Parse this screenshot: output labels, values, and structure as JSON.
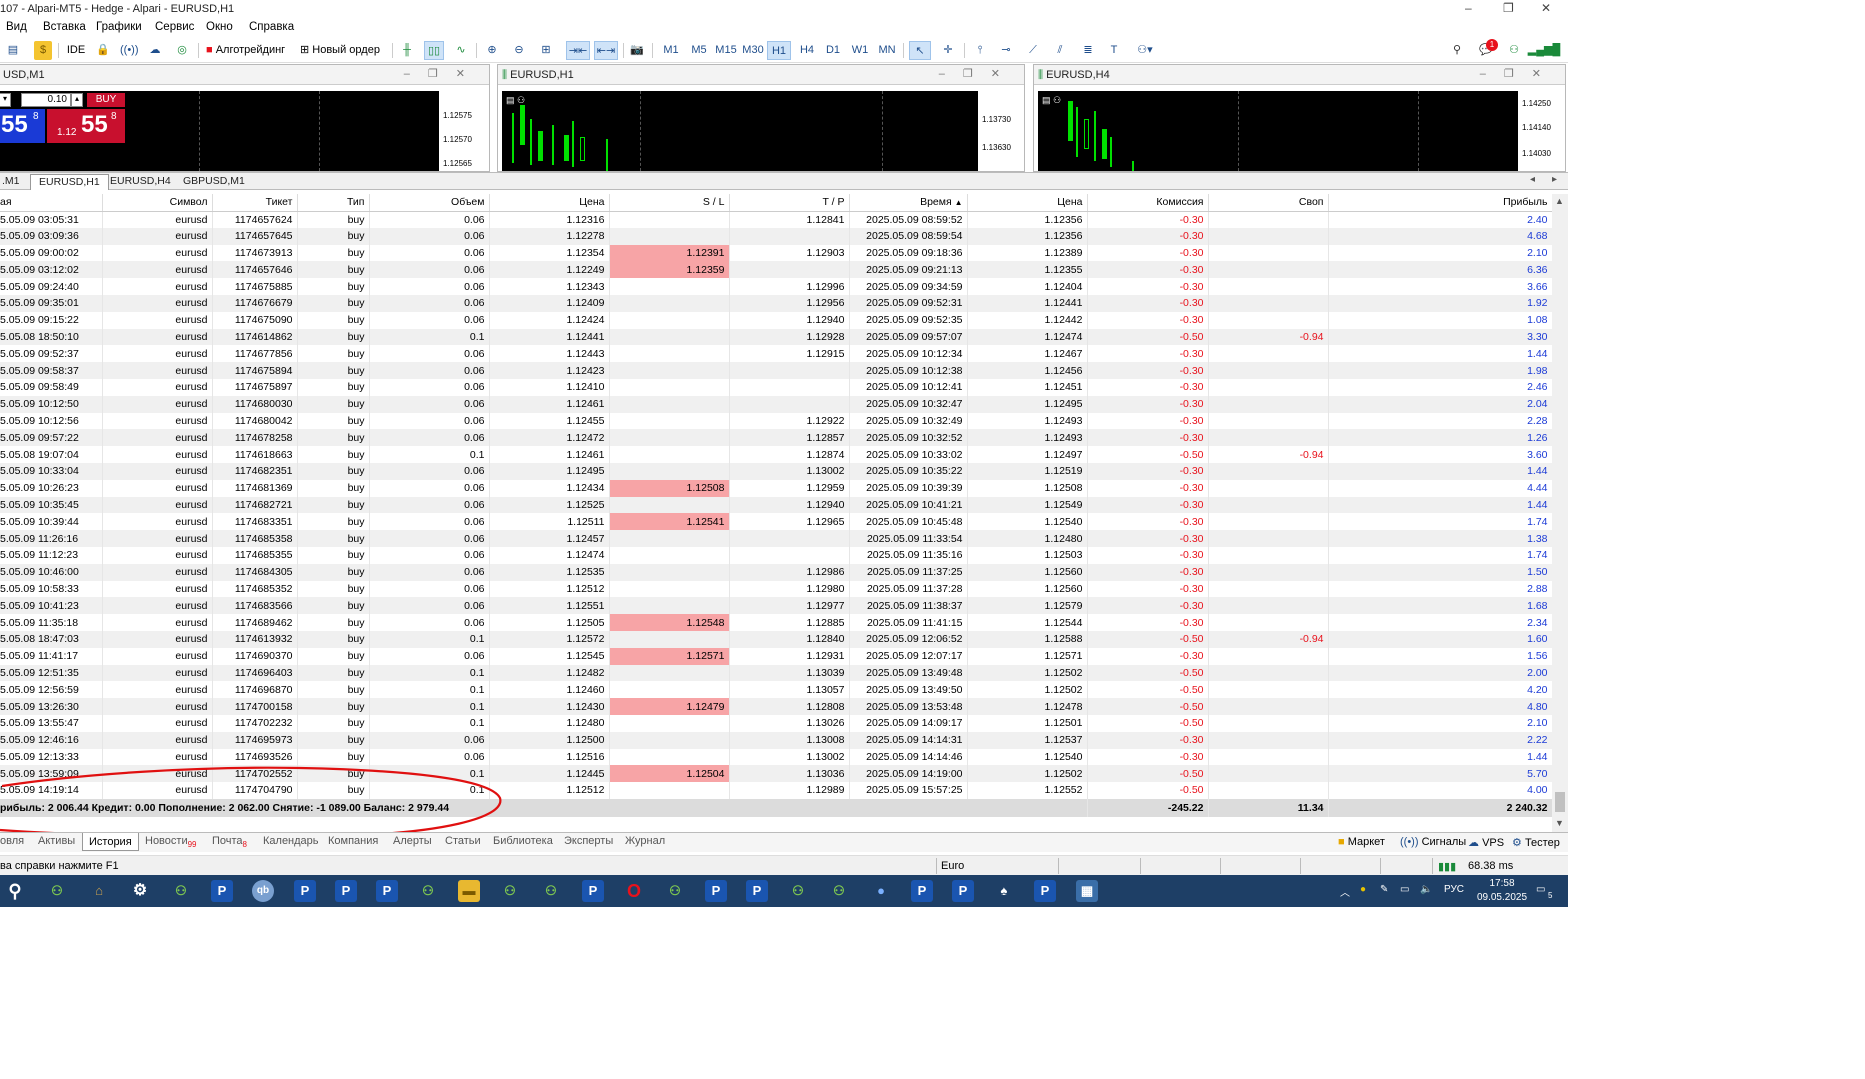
{
  "window": {
    "title": "107 - Alpari-MT5 - Hedge - Alpari - EURUSD,H1",
    "controls": [
      "–",
      "❐",
      "✕"
    ]
  },
  "menu": [
    "Вид",
    "Вставка",
    "Графики",
    "Сервис",
    "Окно",
    "Справка"
  ],
  "toolbar": {
    "ide": "IDE",
    "algotrading": "Алготрейдинг",
    "new_order": "Новый ордер",
    "timeframes": [
      "M1",
      "M5",
      "M15",
      "M30",
      "H1",
      "H4",
      "D1",
      "W1",
      "MN"
    ],
    "selected_timeframe": "H1",
    "notification_count": "1"
  },
  "charts": [
    {
      "title": "USD,M1",
      "lot": "0.10",
      "buy_label": "BUY",
      "sell_price_big": "55",
      "sell_price_sup": "8",
      "buy_price_prefix": "1.12",
      "buy_price_big": "55",
      "buy_price_sup": "8",
      "scale": [
        "1.12575",
        "1.12570",
        "1.12565"
      ]
    },
    {
      "title": "EURUSD,H1",
      "scale": [
        "1.13730",
        "1.13630"
      ]
    },
    {
      "title": "EURUSD,H4",
      "scale": [
        "1.14250",
        "1.14140",
        "1.14030"
      ]
    }
  ],
  "chart_tabs": [
    ".M1",
    "EURUSD,H1",
    "EURUSD,H4",
    "GBPUSD,M1"
  ],
  "active_chart_tab": "EURUSD,H1",
  "table": {
    "headers": [
      "ая",
      "Символ",
      "Тикет",
      "Тип",
      "Объем",
      "Цена",
      "S / L",
      "T / P",
      "Время",
      "Цена",
      "Комиссия",
      "Своп",
      "Прибыль"
    ],
    "rows": [
      [
        "5.05.09 03:05:31",
        "eurusd",
        "1174657624",
        "buy",
        "0.06",
        "1.12316",
        "",
        "1.12841",
        "2025.05.09 08:59:52",
        "1.12356",
        "-0.30",
        "",
        "2.40"
      ],
      [
        "5.05.09 03:09:36",
        "eurusd",
        "1174657645",
        "buy",
        "0.06",
        "1.12278",
        "",
        "",
        "2025.05.09 08:59:54",
        "1.12356",
        "-0.30",
        "",
        "4.68"
      ],
      [
        "5.05.09 09:00:02",
        "eurusd",
        "1174673913",
        "buy",
        "0.06",
        "1.12354",
        "1.12391",
        "1.12903",
        "2025.05.09 09:18:36",
        "1.12389",
        "-0.30",
        "",
        "2.10"
      ],
      [
        "5.05.09 03:12:02",
        "eurusd",
        "1174657646",
        "buy",
        "0.06",
        "1.12249",
        "1.12359",
        "",
        "2025.05.09 09:21:13",
        "1.12355",
        "-0.30",
        "",
        "6.36"
      ],
      [
        "5.05.09 09:24:40",
        "eurusd",
        "1174675885",
        "buy",
        "0.06",
        "1.12343",
        "",
        "1.12996",
        "2025.05.09 09:34:59",
        "1.12404",
        "-0.30",
        "",
        "3.66"
      ],
      [
        "5.05.09 09:35:01",
        "eurusd",
        "1174676679",
        "buy",
        "0.06",
        "1.12409",
        "",
        "1.12956",
        "2025.05.09 09:52:31",
        "1.12441",
        "-0.30",
        "",
        "1.92"
      ],
      [
        "5.05.09 09:15:22",
        "eurusd",
        "1174675090",
        "buy",
        "0.06",
        "1.12424",
        "",
        "1.12940",
        "2025.05.09 09:52:35",
        "1.12442",
        "-0.30",
        "",
        "1.08"
      ],
      [
        "5.05.08 18:50:10",
        "eurusd",
        "1174614862",
        "buy",
        "0.1",
        "1.12441",
        "",
        "1.12928",
        "2025.05.09 09:57:07",
        "1.12474",
        "-0.50",
        "-0.94",
        "3.30"
      ],
      [
        "5.05.09 09:52:37",
        "eurusd",
        "1174677856",
        "buy",
        "0.06",
        "1.12443",
        "",
        "1.12915",
        "2025.05.09 10:12:34",
        "1.12467",
        "-0.30",
        "",
        "1.44"
      ],
      [
        "5.05.09 09:58:37",
        "eurusd",
        "1174675894",
        "buy",
        "0.06",
        "1.12423",
        "",
        "",
        "2025.05.09 10:12:38",
        "1.12456",
        "-0.30",
        "",
        "1.98"
      ],
      [
        "5.05.09 09:58:49",
        "eurusd",
        "1174675897",
        "buy",
        "0.06",
        "1.12410",
        "",
        "",
        "2025.05.09 10:12:41",
        "1.12451",
        "-0.30",
        "",
        "2.46"
      ],
      [
        "5.05.09 10:12:50",
        "eurusd",
        "1174680030",
        "buy",
        "0.06",
        "1.12461",
        "",
        "",
        "2025.05.09 10:32:47",
        "1.12495",
        "-0.30",
        "",
        "2.04"
      ],
      [
        "5.05.09 10:12:56",
        "eurusd",
        "1174680042",
        "buy",
        "0.06",
        "1.12455",
        "",
        "1.12922",
        "2025.05.09 10:32:49",
        "1.12493",
        "-0.30",
        "",
        "2.28"
      ],
      [
        "5.05.09 09:57:22",
        "eurusd",
        "1174678258",
        "buy",
        "0.06",
        "1.12472",
        "",
        "1.12857",
        "2025.05.09 10:32:52",
        "1.12493",
        "-0.30",
        "",
        "1.26"
      ],
      [
        "5.05.08 19:07:04",
        "eurusd",
        "1174618663",
        "buy",
        "0.1",
        "1.12461",
        "",
        "1.12874",
        "2025.05.09 10:33:02",
        "1.12497",
        "-0.50",
        "-0.94",
        "3.60"
      ],
      [
        "5.05.09 10:33:04",
        "eurusd",
        "1174682351",
        "buy",
        "0.06",
        "1.12495",
        "",
        "1.13002",
        "2025.05.09 10:35:22",
        "1.12519",
        "-0.30",
        "",
        "1.44"
      ],
      [
        "5.05.09 10:26:23",
        "eurusd",
        "1174681369",
        "buy",
        "0.06",
        "1.12434",
        "1.12508",
        "1.12959",
        "2025.05.09 10:39:39",
        "1.12508",
        "-0.30",
        "",
        "4.44"
      ],
      [
        "5.05.09 10:35:45",
        "eurusd",
        "1174682721",
        "buy",
        "0.06",
        "1.12525",
        "",
        "1.12940",
        "2025.05.09 10:41:21",
        "1.12549",
        "-0.30",
        "",
        "1.44"
      ],
      [
        "5.05.09 10:39:44",
        "eurusd",
        "1174683351",
        "buy",
        "0.06",
        "1.12511",
        "1.12541",
        "1.12965",
        "2025.05.09 10:45:48",
        "1.12540",
        "-0.30",
        "",
        "1.74"
      ],
      [
        "5.05.09 11:26:16",
        "eurusd",
        "1174685358",
        "buy",
        "0.06",
        "1.12457",
        "",
        "",
        "2025.05.09 11:33:54",
        "1.12480",
        "-0.30",
        "",
        "1.38"
      ],
      [
        "5.05.09 11:12:23",
        "eurusd",
        "1174685355",
        "buy",
        "0.06",
        "1.12474",
        "",
        "",
        "2025.05.09 11:35:16",
        "1.12503",
        "-0.30",
        "",
        "1.74"
      ],
      [
        "5.05.09 10:46:00",
        "eurusd",
        "1174684305",
        "buy",
        "0.06",
        "1.12535",
        "",
        "1.12986",
        "2025.05.09 11:37:25",
        "1.12560",
        "-0.30",
        "",
        "1.50"
      ],
      [
        "5.05.09 10:58:33",
        "eurusd",
        "1174685352",
        "buy",
        "0.06",
        "1.12512",
        "",
        "1.12980",
        "2025.05.09 11:37:28",
        "1.12560",
        "-0.30",
        "",
        "2.88"
      ],
      [
        "5.05.09 10:41:23",
        "eurusd",
        "1174683566",
        "buy",
        "0.06",
        "1.12551",
        "",
        "1.12977",
        "2025.05.09 11:38:37",
        "1.12579",
        "-0.30",
        "",
        "1.68"
      ],
      [
        "5.05.09 11:35:18",
        "eurusd",
        "1174689462",
        "buy",
        "0.06",
        "1.12505",
        "1.12548",
        "1.12885",
        "2025.05.09 11:41:15",
        "1.12544",
        "-0.30",
        "",
        "2.34"
      ],
      [
        "5.05.08 18:47:03",
        "eurusd",
        "1174613932",
        "buy",
        "0.1",
        "1.12572",
        "",
        "1.12840",
        "2025.05.09 12:06:52",
        "1.12588",
        "-0.50",
        "-0.94",
        "1.60"
      ],
      [
        "5.05.09 11:41:17",
        "eurusd",
        "1174690370",
        "buy",
        "0.06",
        "1.12545",
        "1.12571",
        "1.12931",
        "2025.05.09 12:07:17",
        "1.12571",
        "-0.30",
        "",
        "1.56"
      ],
      [
        "5.05.09 12:51:35",
        "eurusd",
        "1174696403",
        "buy",
        "0.1",
        "1.12482",
        "",
        "1.13039",
        "2025.05.09 13:49:48",
        "1.12502",
        "-0.50",
        "",
        "2.00"
      ],
      [
        "5.05.09 12:56:59",
        "eurusd",
        "1174696870",
        "buy",
        "0.1",
        "1.12460",
        "",
        "1.13057",
        "2025.05.09 13:49:50",
        "1.12502",
        "-0.50",
        "",
        "4.20"
      ],
      [
        "5.05.09 13:26:30",
        "eurusd",
        "1174700158",
        "buy",
        "0.1",
        "1.12430",
        "1.12479",
        "1.12808",
        "2025.05.09 13:53:48",
        "1.12478",
        "-0.50",
        "",
        "4.80"
      ],
      [
        "5.05.09 13:55:47",
        "eurusd",
        "1174702232",
        "buy",
        "0.1",
        "1.12480",
        "",
        "1.13026",
        "2025.05.09 14:09:17",
        "1.12501",
        "-0.50",
        "",
        "2.10"
      ],
      [
        "5.05.09 12:46:16",
        "eurusd",
        "1174695973",
        "buy",
        "0.06",
        "1.12500",
        "",
        "1.13008",
        "2025.05.09 14:14:31",
        "1.12537",
        "-0.30",
        "",
        "2.22"
      ],
      [
        "5.05.09 12:13:33",
        "eurusd",
        "1174693526",
        "buy",
        "0.06",
        "1.12516",
        "",
        "1.13002",
        "2025.05.09 14:14:46",
        "1.12540",
        "-0.30",
        "",
        "1.44"
      ],
      [
        "5.05.09 13:59:09",
        "eurusd",
        "1174702552",
        "buy",
        "0.1",
        "1.12445",
        "1.12504",
        "1.13036",
        "2025.05.09 14:19:00",
        "1.12502",
        "-0.50",
        "",
        "5.70"
      ],
      [
        "5.05.09 14:19:14",
        "eurusd",
        "1174704790",
        "buy",
        "0.1",
        "1.12512",
        "",
        "1.12989",
        "2025.05.09 15:57:25",
        "1.12552",
        "-0.50",
        "",
        "4.00"
      ]
    ],
    "summary": "рибыль: 2 006.44  Кредит: 0.00  Пополнение: 2 062.00  Снятие: -1 089.00  Баланс: 2 979.44",
    "total_commission": "-245.22",
    "total_swap": "11.34",
    "total_profit": "2 240.32"
  },
  "bottom_tabs": [
    {
      "label": "овля",
      "badge": ""
    },
    {
      "label": "Активы",
      "badge": ""
    },
    {
      "label": "История",
      "badge": ""
    },
    {
      "label": "Новости",
      "badge": "99"
    },
    {
      "label": "Почта",
      "badge": "8"
    },
    {
      "label": "Календарь",
      "badge": ""
    },
    {
      "label": "Компания",
      "badge": ""
    },
    {
      "label": "Алерты",
      "badge": ""
    },
    {
      "label": "Статьи",
      "badge": ""
    },
    {
      "label": "Библиотека",
      "badge": ""
    },
    {
      "label": "Эксперты",
      "badge": ""
    },
    {
      "label": "Журнал",
      "badge": ""
    }
  ],
  "active_bottom_tab": "История",
  "bottom_right": [
    "Маркет",
    "Сигналы",
    "VPS",
    "Тестер"
  ],
  "status": {
    "help": "ва справки нажмите F1",
    "profile": "Euro",
    "ping": "68.38 ms"
  },
  "taskbar": {
    "lang": "РУС",
    "time": "17:58",
    "date": "09.05.2025",
    "notif": "5"
  },
  "colors": {
    "sl_hit": "#f7a4a6",
    "negative": "#e8121c",
    "positive": "#1b3ad6",
    "annotation": "#e01010"
  }
}
